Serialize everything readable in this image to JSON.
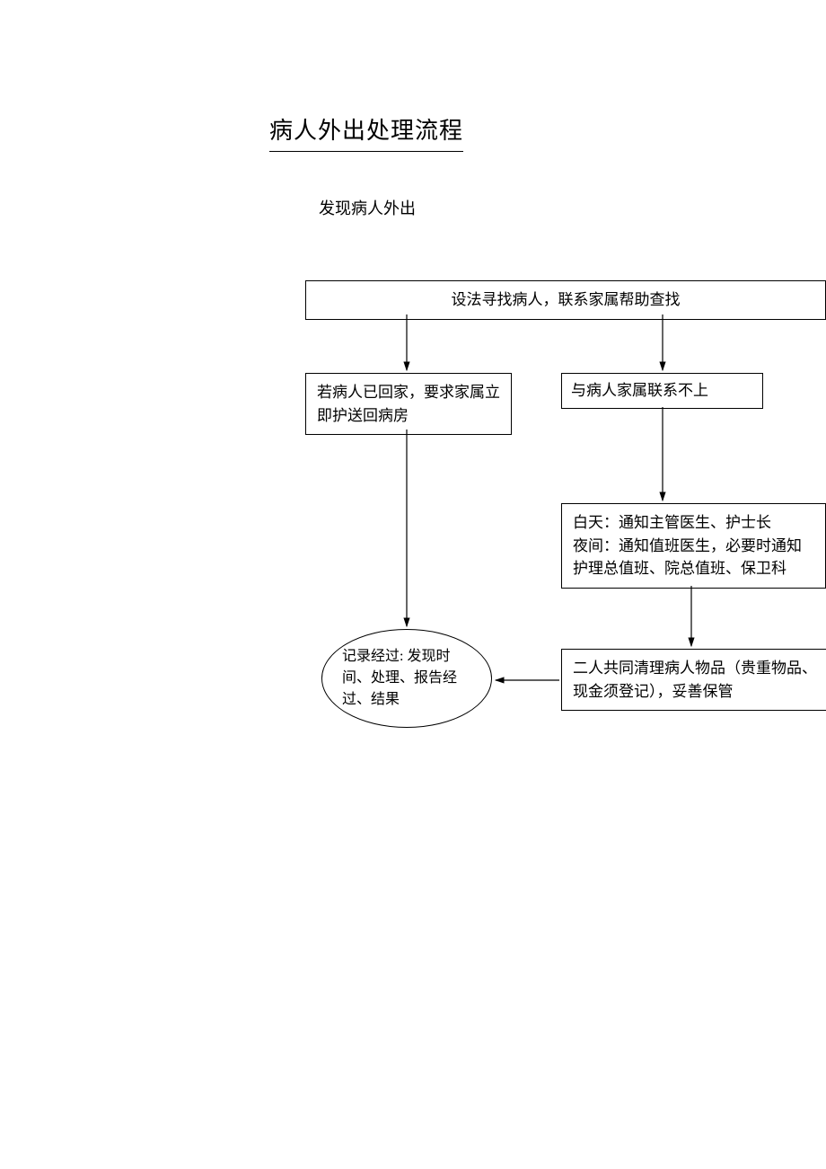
{
  "title": "病人外出处理流程",
  "subtitle": "发现病人外出",
  "nodes": {
    "search": "设法寻找病人，联系家属帮助查找",
    "home": "若病人已回家，要求家属立即护送回病房",
    "no_contact": "与病人家属联系不上",
    "notify": "白天：通知主管医生、护士长\n夜间：通知值班医生，必要时通知护理总值班、院总值班、保卫科",
    "clean": "二人共同清理病人物品（贵重物品、现金须登记），妥善保管",
    "record": "记录经过: 发现时间、处理、报告经过、结果"
  }
}
